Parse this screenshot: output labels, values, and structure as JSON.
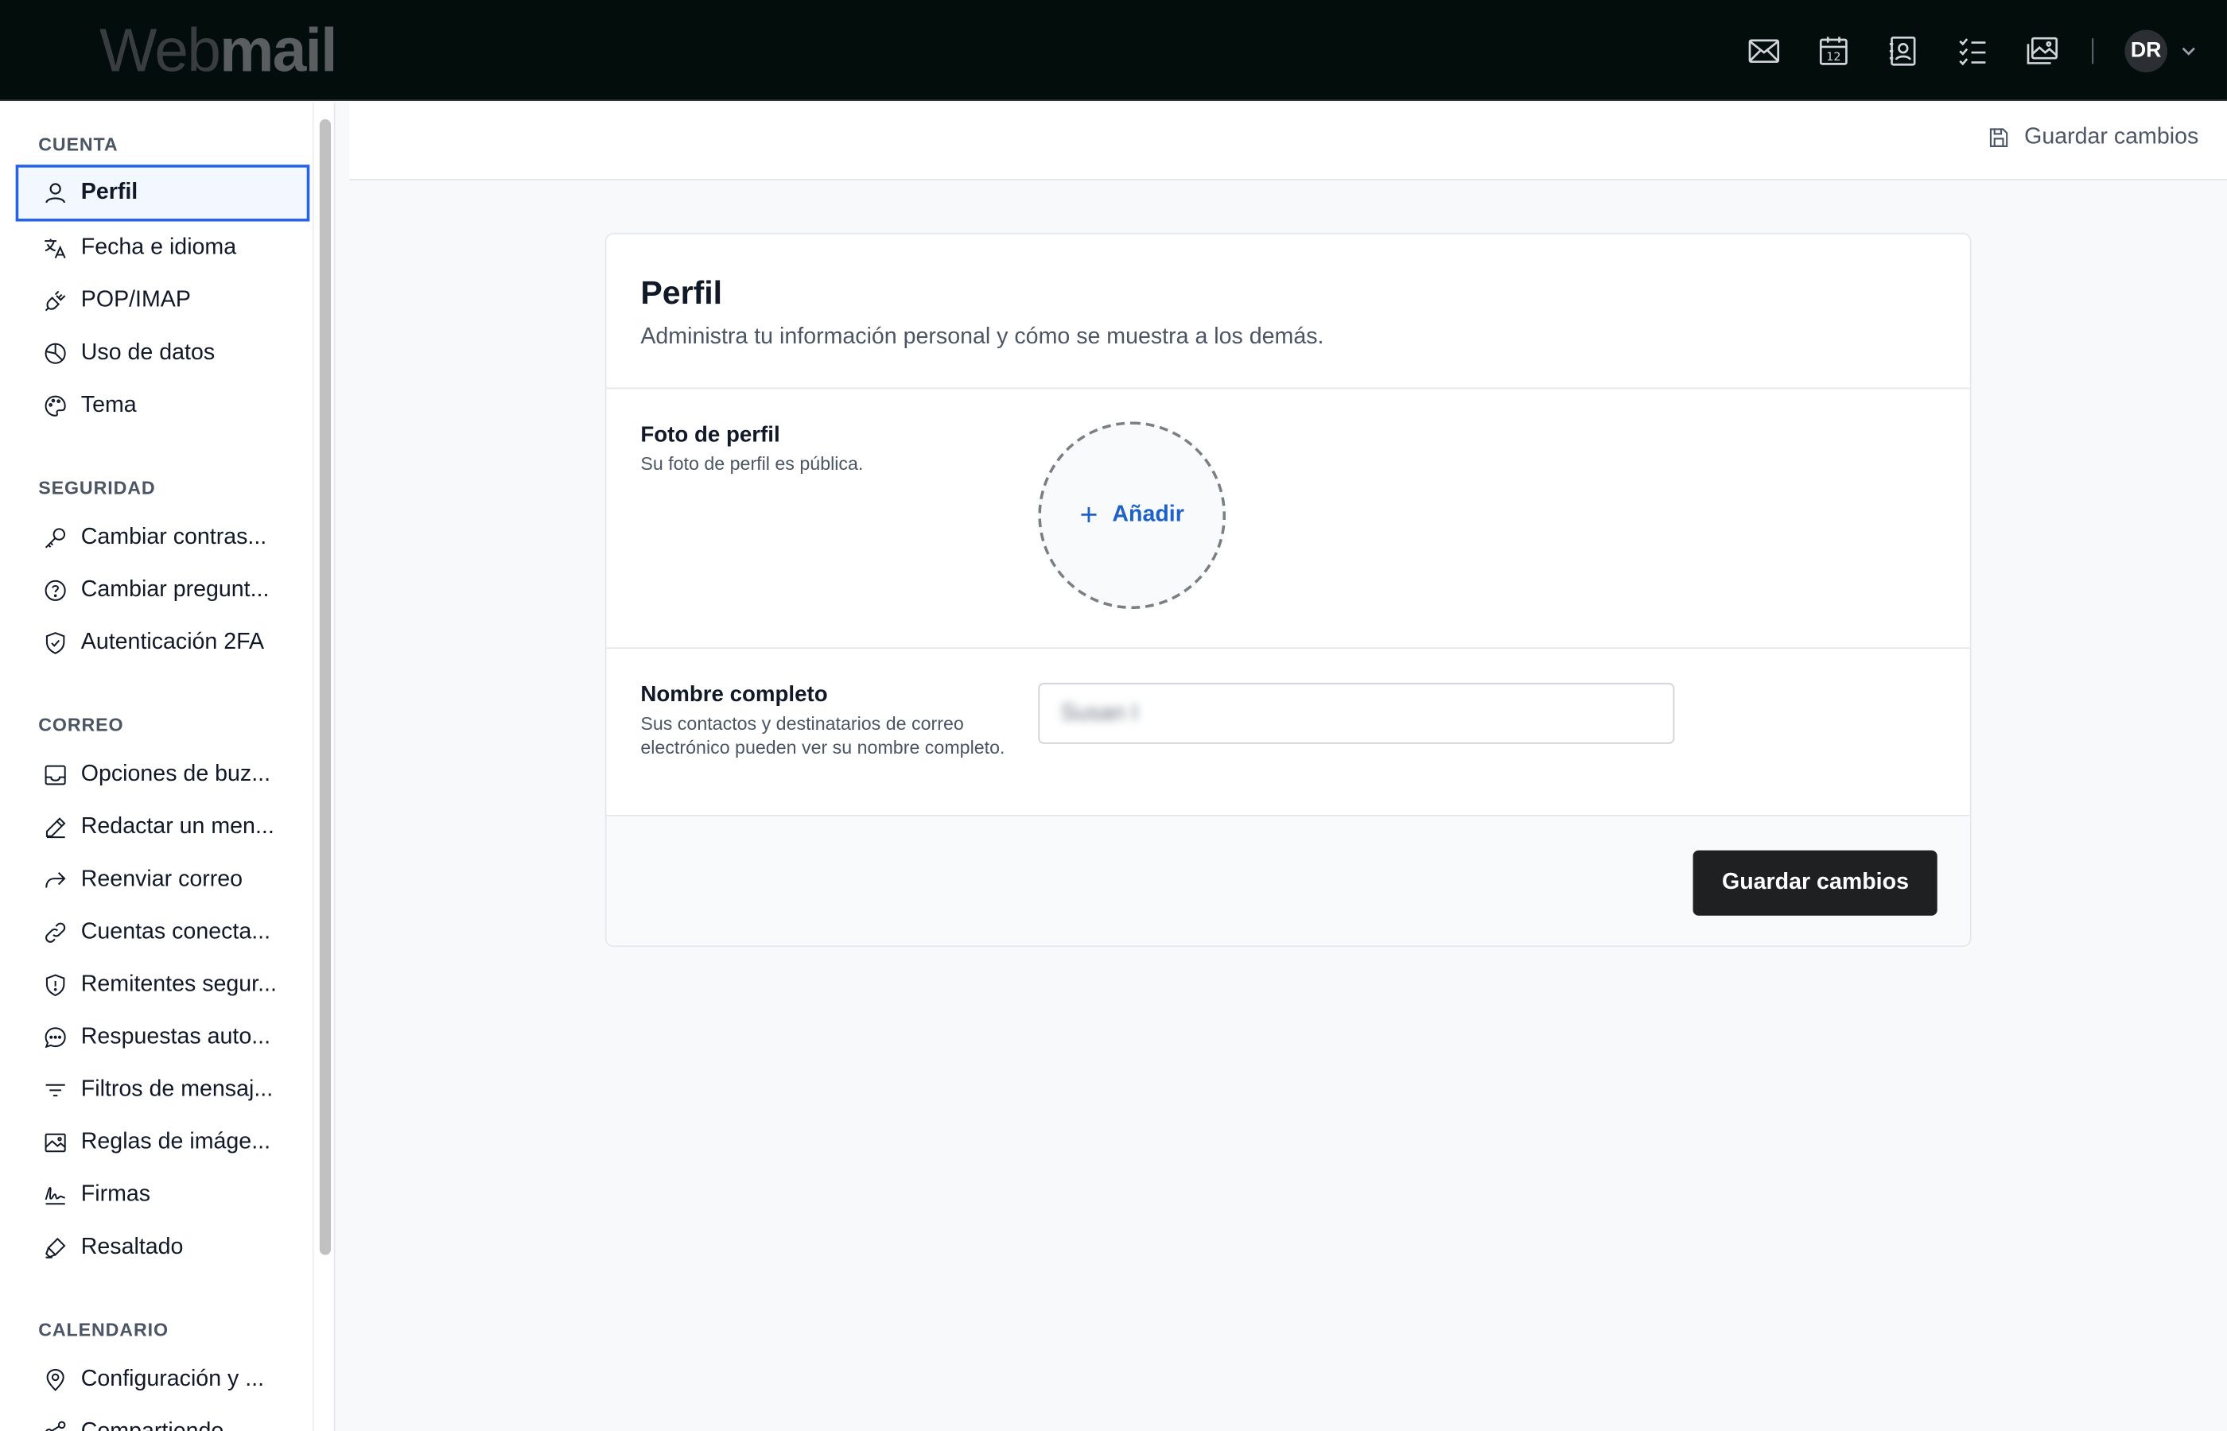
{
  "app": {
    "logo_light": "Web",
    "logo_bold": "mail"
  },
  "topbar": {
    "icons": [
      "mail-icon",
      "calendar-icon",
      "contacts-icon",
      "tasks-icon",
      "photos-icon"
    ],
    "calendar_day": "12",
    "avatar_initials": "DR"
  },
  "sidebar": {
    "sections": [
      {
        "title": "CUENTA",
        "items": [
          {
            "label": "Perfil",
            "icon": "user-icon",
            "active": true
          },
          {
            "label": "Fecha e idioma",
            "icon": "translate-icon"
          },
          {
            "label": "POP/IMAP",
            "icon": "plug-icon"
          },
          {
            "label": "Uso de datos",
            "icon": "pie-chart-icon"
          },
          {
            "label": "Tema",
            "icon": "palette-icon"
          }
        ]
      },
      {
        "title": "SEGURIDAD",
        "items": [
          {
            "label": "Cambiar contras...",
            "icon": "key-icon"
          },
          {
            "label": "Cambiar pregunt...",
            "icon": "question-icon"
          },
          {
            "label": "Autenticación 2FA",
            "icon": "shield-check-icon"
          }
        ]
      },
      {
        "title": "CORREO",
        "items": [
          {
            "label": "Opciones de buz...",
            "icon": "inbox-icon"
          },
          {
            "label": "Redactar un men...",
            "icon": "pencil-icon"
          },
          {
            "label": "Reenviar correo",
            "icon": "forward-icon"
          },
          {
            "label": "Cuentas conecta...",
            "icon": "link-icon"
          },
          {
            "label": "Remitentes segur...",
            "icon": "shield-alert-icon"
          },
          {
            "label": "Respuestas auto...",
            "icon": "chat-icon"
          },
          {
            "label": "Filtros de mensaj...",
            "icon": "filter-icon"
          },
          {
            "label": "Reglas de imáge...",
            "icon": "image-icon"
          },
          {
            "label": "Firmas",
            "icon": "signature-icon"
          },
          {
            "label": "Resaltado",
            "icon": "highlighter-icon"
          }
        ]
      },
      {
        "title": "CALENDARIO",
        "items": [
          {
            "label": "Configuración y ...",
            "icon": "location-icon"
          },
          {
            "label": "Compartiendo",
            "icon": "share-icon"
          }
        ]
      }
    ]
  },
  "header": {
    "save_label": "Guardar cambios"
  },
  "profile": {
    "title": "Perfil",
    "description": "Administra tu información personal y cómo se muestra a los demás.",
    "photo_label": "Foto de perfil",
    "photo_hint": "Su foto de perfil es pública.",
    "photo_add": "Añadir",
    "name_label": "Nombre completo",
    "name_hint": "Sus contactos y destinatarios de correo electrónico pueden ver su nombre completo.",
    "name_value": "Susan I",
    "save_button": "Guardar cambios"
  },
  "colors": {
    "accent": "#2563eb",
    "link": "#1d62c9",
    "topbar_bg": "#030d0b",
    "primary_button": "#1f2022"
  }
}
